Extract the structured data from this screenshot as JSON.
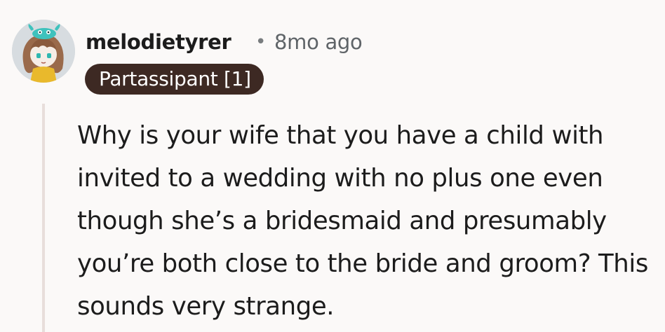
{
  "comment": {
    "username": "melodietyrer",
    "separator": "•",
    "timestamp": "8mo ago",
    "flair": "Partassipant [1]",
    "body": "Why is your wife that you have a child with invited to a wedding with no plus one even though she’s a bridesmaid and presumably you’re both close to the bride and groom? This sounds very strange."
  },
  "colors": {
    "background": "#fbf9f8",
    "flair_background": "#3d2923",
    "flair_text": "#ffffff",
    "thread_line": "#e8dedb",
    "meta_text": "#5f6468"
  },
  "icons": {
    "avatar": "user-avatar-cartoon-icon"
  }
}
